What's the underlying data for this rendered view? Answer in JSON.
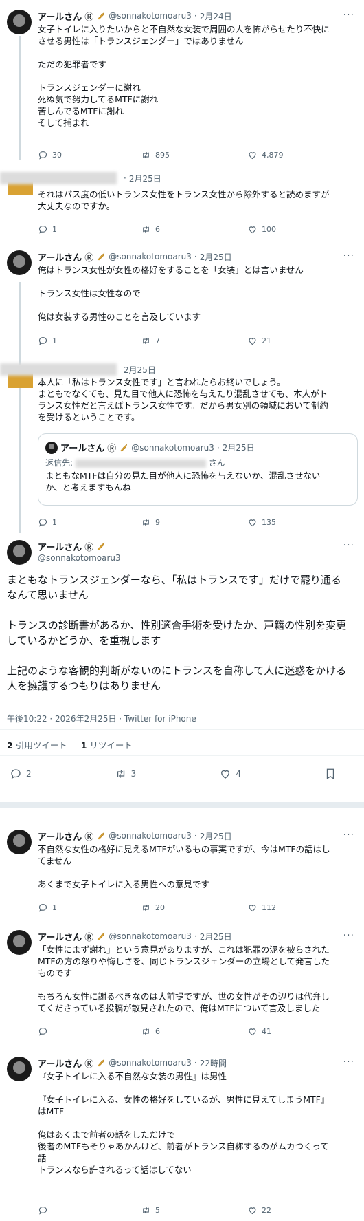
{
  "author": {
    "name": "アールさん",
    "badge": "Ⓡ",
    "handle": "@sonnakotomoaru3",
    "more": "···"
  },
  "tweets": [
    {
      "date": "2月24日",
      "text": "女子トイレに入りたいからと不自然な女装で周囲の人を怖がらせたり不快に\nさせる男性は「トランスジェンダー」ではありません\n\nただの犯罪者です\n\nトランスジェンダーに謝れ\n死ぬ気で努力してるMTFに謝れ\n苦しんでるMTFに謝れ\nそして捕まれ",
      "replies": "30",
      "retweets": "895",
      "likes": "4,879"
    },
    {
      "date": "2月25日",
      "text": "それはパス度の低いトランス女性をトランス女性から除外すると読めますが\n大丈夫なのですか。",
      "replies": "1",
      "retweets": "6",
      "likes": "100"
    },
    {
      "date": "2月25日",
      "text": "俺はトランス女性が女性の格好をすることを「女装」とは言いません\n\nトランス女性は女性なので\n\n俺は女装する男性のことを言及しています",
      "replies": "1",
      "retweets": "7",
      "likes": "21"
    },
    {
      "date": "2月25日",
      "text": "本人に「私はトランス女性です」と言われたらお終いでしょう。\nまともでなくても、見た目で他人に恐怖を与えたり混乱させても、本人がト\nランス女性だと言えばトランス女性です。だから男女別の領域において制約\nを受けるということです。",
      "replies": "1",
      "retweets": "9",
      "likes": "135",
      "quote": {
        "date": "2月25日",
        "reply_to_label": "返信先:",
        "reply_to_suffix": "さん",
        "text": "まともなMTFは自分の見た目が他人に恐怖を与えないか、混乱させない\nか、と考えますもんね"
      }
    }
  ],
  "main_tweet": {
    "text": "まともなトランスジェンダーなら、「私はトランスです」だけで罷り通る\nなんて思いません\n\nトランスの診断書があるか、性別適合手術を受けたか、戸籍の性別を変更\nしているかどうか、を重視します\n\n上記のような客観的判断がないのにトランスを自称して人に迷惑をかける\n人を擁護するつもりはありません",
    "meta": "午後10:22 · 2026年2月25日 · Twitter for iPhone",
    "quote_count": "2",
    "quote_label": "引用ツイート",
    "retweet_count": "1",
    "retweet_label": "リツイート",
    "replies": "2",
    "retweets": "3",
    "likes": "4"
  },
  "replies": [
    {
      "date": "2月25日",
      "text": "不自然な女性の格好に見えるMTFがいるもの事実ですが、今はMTFの話はし\nてません\n\nあくまで女子トイレに入る男性への意見です",
      "replies": "1",
      "retweets": "20",
      "likes": "112"
    },
    {
      "date": "2月25日",
      "text": "「女性にまず謝れ」という意見がありますが、これは犯罪の泥を被らされた\nMTFの方の怒りや悔しさを、同じトランスジェンダーの立場として発言した\nものです\n\nもちろん女性に謝るべきなのは大前提ですが、世の女性がその辺りは代弁し\nてくださっている投稿が散見されたので、俺はMTFについて言及しました",
      "replies": "",
      "retweets": "6",
      "likes": "41"
    },
    {
      "date": "22時間",
      "text": "『女子トイレに入る不自然な女装の男性』は男性\n\n『女子トイレに入る、女性の格好をしているが、男性に見えてしまうMTF』\nはMTF\n\n俺はあくまで前者の話をしただけで\n後者のMTFもそりゃあかんけど、前者がトランス自称するのがムカつくって\n話\nトランスなら許されるって話はしてない",
      "replies": "",
      "retweets": "5",
      "likes": "22"
    }
  ],
  "icons": {
    "reply": "reply-icon",
    "retweet": "retweet-icon",
    "like": "heart-icon",
    "bookmark": "bookmark-icon",
    "verified": "saxophone-badge-icon"
  }
}
